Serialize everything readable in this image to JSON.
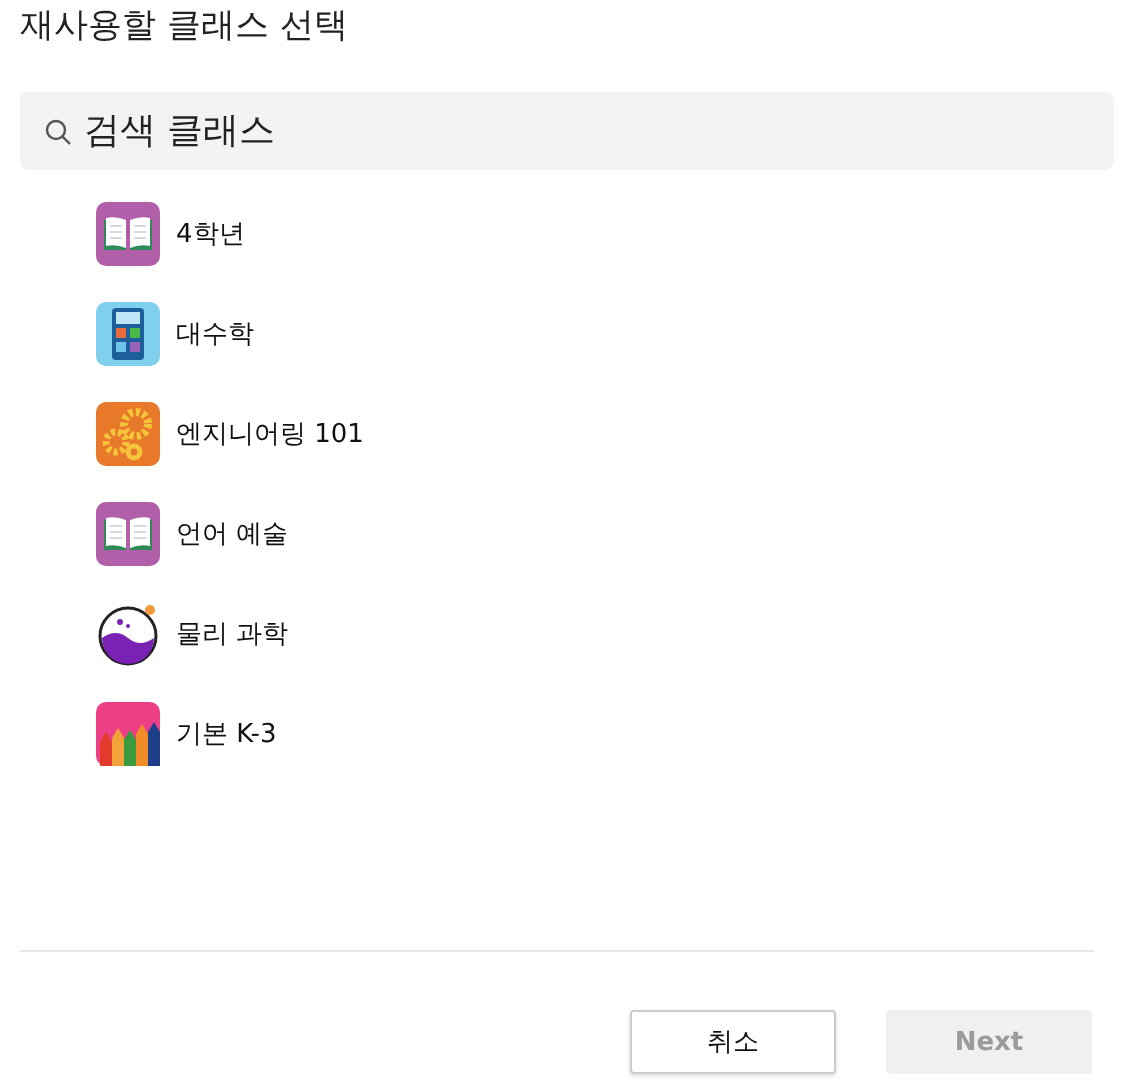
{
  "title": "재사용할 클래스 선택",
  "search": {
    "placeholder": "검색 클래스"
  },
  "classes": [
    {
      "name": "4학년",
      "kind": "book"
    },
    {
      "name": "대수학",
      "kind": "calculator"
    },
    {
      "name": "엔지니어링 101",
      "kind": "gears"
    },
    {
      "name": "언어 예술",
      "kind": "book"
    },
    {
      "name": "물리 과학",
      "kind": "flask"
    },
    {
      "name": "기본 K-3",
      "kind": "pencils"
    }
  ],
  "buttons": {
    "cancel": "취소",
    "next": {
      "label": "Next",
      "disabled": true
    }
  }
}
